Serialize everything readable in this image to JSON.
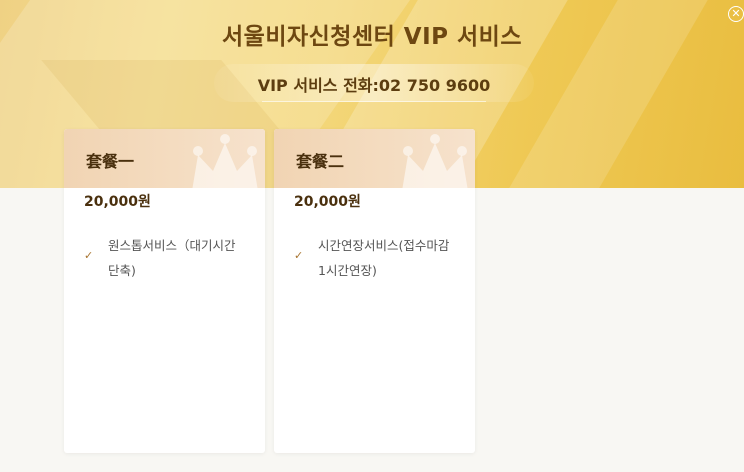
{
  "header": {
    "title": "서울비자신청센터 VIP 서비스",
    "phone": "VIP 서비스 전화:02 750 9600"
  },
  "close": {
    "label": "✕"
  },
  "packages": [
    {
      "name": "套餐一",
      "price": "20,000원",
      "check_icon": "✓",
      "feature": "원스톱서비스（대기시간단축)"
    },
    {
      "name": "套餐二",
      "price": "20,000원",
      "check_icon": "✓",
      "feature": "시간연장서비스(접수마감1시간연장)"
    }
  ],
  "colors": {
    "title": "#6d4711",
    "card_header": "#f1d4b3",
    "check": "#a8742f"
  }
}
